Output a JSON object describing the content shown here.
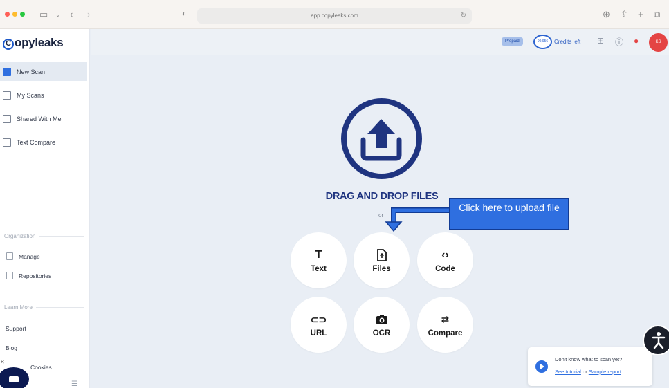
{
  "browser": {
    "url": "app.copyleaks.com",
    "traffic_colors": [
      "#ff5f57",
      "#febc2e",
      "#28c840"
    ]
  },
  "sidebar": {
    "logo": "opyleaks",
    "logo_mark": "C",
    "nav": [
      {
        "label": "New Scan",
        "icon": "new-scan-icon",
        "active": true
      },
      {
        "label": "My Scans",
        "icon": "folder-icon",
        "active": false
      },
      {
        "label": "Shared With Me",
        "icon": "shared-folder-icon",
        "active": false
      },
      {
        "label": "Text Compare",
        "icon": "compare-icon",
        "active": false
      }
    ],
    "org_header": "Organization",
    "org_items": [
      {
        "label": "Manage",
        "icon": "manage-icon"
      },
      {
        "label": "Repositories",
        "icon": "repository-icon"
      }
    ],
    "learn_header": "Learn More",
    "learn_items": [
      {
        "label": "Support"
      },
      {
        "label": "Blog"
      },
      {
        "label": "Cookies"
      }
    ]
  },
  "topbar": {
    "plan_badge": "Prepaid",
    "credits_value": "99,956",
    "credits_label": "Credits left",
    "avatar_initials": "KS",
    "avatar_color": "#e44444"
  },
  "main": {
    "drag_title": "DRAG AND DROP FILES",
    "or": "or",
    "options": [
      {
        "label": "Text",
        "icon": "text-icon"
      },
      {
        "label": "Files",
        "icon": "file-upload-icon"
      },
      {
        "label": "Code",
        "icon": "code-icon"
      },
      {
        "label": "URL",
        "icon": "link-icon"
      },
      {
        "label": "OCR",
        "icon": "camera-icon"
      },
      {
        "label": "Compare",
        "icon": "compare-arrows-icon"
      }
    ],
    "accent": "#1f3480"
  },
  "callout": {
    "text": "Click here to upload file"
  },
  "toast": {
    "question": "Don't know what to scan yet?",
    "tutorial_link": "See tutorial",
    "or": "or",
    "sample_link": "Sample report"
  }
}
